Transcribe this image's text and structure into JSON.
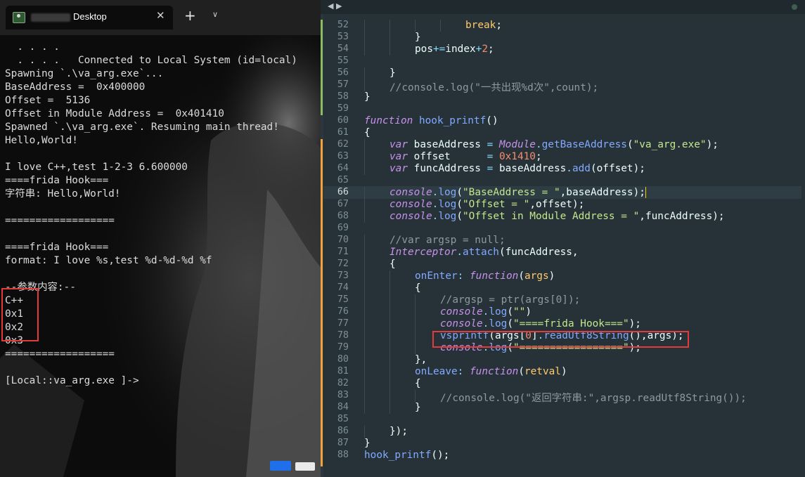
{
  "terminal": {
    "tab_title": "Desktop",
    "close_glyph": "✕",
    "new_tab_glyph": "+",
    "dropdown_glyph": "∨",
    "icon": "terminal-icon",
    "lines": [
      "  . . . .",
      "  . . . .   Connected to Local System (id=local)",
      "Spawning `.\\va_arg.exe`...",
      "BaseAddress =  0x400000",
      "Offset =  5136",
      "Offset in Module Address =  0x401410",
      "Spawned `.\\va_arg.exe`. Resuming main thread!",
      "Hello,World!",
      "",
      "I love C++,test 1-2-3 6.600000",
      "====frida Hook===",
      "字符串: Hello,World!",
      "",
      "==================",
      "",
      "====frida Hook===",
      "format: I love %s,test %d-%d-%d %f",
      "",
      "--参数内容:--",
      "C++",
      "0x1",
      "0x2",
      "0x3",
      "==================",
      "",
      "[Local::va_arg.exe ]->"
    ]
  },
  "editor": {
    "nav_back": "◀",
    "nav_fwd": "▶",
    "active_line": 66,
    "colors": {
      "background": "#263238",
      "keyword": "#c792ea",
      "function": "#82aaff",
      "string": "#c3e88d",
      "number": "#f78c6c",
      "comment": "#8d9aa1",
      "highlight_box": "#e23b3b"
    },
    "line_numbers": [
      "52",
      "53",
      "54",
      "55",
      "56",
      "57",
      "58",
      "59",
      "60",
      "61",
      "62",
      "63",
      "64",
      "65",
      "66",
      "67",
      "68",
      "69",
      "70",
      "71",
      "72",
      "73",
      "74",
      "75",
      "76",
      "77",
      "78",
      "79",
      "80",
      "81",
      "82",
      "83",
      "84",
      "85",
      "86",
      "87",
      "88"
    ],
    "code": [
      {
        "indent": 4,
        "tokens": [
          [
            "kwb",
            "break"
          ],
          [
            "pun",
            ";"
          ]
        ]
      },
      {
        "indent": 2,
        "tokens": [
          [
            "pun",
            "}"
          ]
        ]
      },
      {
        "indent": 2,
        "tokens": [
          [
            "pun",
            "pos"
          ],
          [
            "op",
            "+="
          ],
          [
            "pun",
            "index"
          ],
          [
            "op",
            "+"
          ],
          [
            "num",
            "2"
          ],
          [
            "pun",
            ";"
          ]
        ]
      },
      {
        "indent": 0,
        "tokens": []
      },
      {
        "indent": 1,
        "tokens": [
          [
            "pun",
            "}"
          ]
        ]
      },
      {
        "indent": 1,
        "tokens": [
          [
            "cm",
            "//console.log(\"一共出现%d次\",count);"
          ]
        ]
      },
      {
        "indent": 0,
        "tokens": [
          [
            "pun",
            "}"
          ]
        ]
      },
      {
        "indent": 0,
        "tokens": []
      },
      {
        "indent": 0,
        "tokens": [
          [
            "kw",
            "function"
          ],
          [
            "pun",
            " "
          ],
          [
            "fn",
            "hook_printf"
          ],
          [
            "pun",
            "()"
          ]
        ]
      },
      {
        "indent": 0,
        "tokens": [
          [
            "pun",
            "{"
          ]
        ]
      },
      {
        "indent": 1,
        "tokens": [
          [
            "kw",
            "var"
          ],
          [
            "pun",
            " baseAddress "
          ],
          [
            "op",
            "="
          ],
          [
            "pun",
            " "
          ],
          [
            "cls",
            "Module"
          ],
          [
            "op",
            "."
          ],
          [
            "fn",
            "getBaseAddress"
          ],
          [
            "pun",
            "("
          ],
          [
            "str",
            "\"va_arg.exe\""
          ],
          [
            "pun",
            ");"
          ]
        ]
      },
      {
        "indent": 1,
        "tokens": [
          [
            "kw",
            "var"
          ],
          [
            "pun",
            " offset      "
          ],
          [
            "op",
            "="
          ],
          [
            "pun",
            " "
          ],
          [
            "num",
            "0x1410"
          ],
          [
            "pun",
            ";"
          ]
        ]
      },
      {
        "indent": 1,
        "tokens": [
          [
            "kw",
            "var"
          ],
          [
            "pun",
            " funcAddress "
          ],
          [
            "op",
            "="
          ],
          [
            "pun",
            " baseAddress"
          ],
          [
            "op",
            "."
          ],
          [
            "fn",
            "add"
          ],
          [
            "pun",
            "(offset);"
          ]
        ]
      },
      {
        "indent": 0,
        "tokens": []
      },
      {
        "indent": 1,
        "tokens": [
          [
            "cls",
            "console"
          ],
          [
            "op",
            "."
          ],
          [
            "fn",
            "log"
          ],
          [
            "pun",
            "("
          ],
          [
            "str",
            "\"BaseAddress = \""
          ],
          [
            "pun",
            ",baseAddress);"
          ]
        ],
        "cursor": true
      },
      {
        "indent": 1,
        "tokens": [
          [
            "cls",
            "console"
          ],
          [
            "op",
            "."
          ],
          [
            "fn",
            "log"
          ],
          [
            "pun",
            "("
          ],
          [
            "str",
            "\"Offset = \""
          ],
          [
            "pun",
            ",offset);"
          ]
        ]
      },
      {
        "indent": 1,
        "tokens": [
          [
            "cls",
            "console"
          ],
          [
            "op",
            "."
          ],
          [
            "fn",
            "log"
          ],
          [
            "pun",
            "("
          ],
          [
            "str",
            "\"Offset in Module Address = \""
          ],
          [
            "pun",
            ",funcAddress);"
          ]
        ]
      },
      {
        "indent": 0,
        "tokens": []
      },
      {
        "indent": 1,
        "tokens": [
          [
            "cm",
            "//var argsp = null;"
          ]
        ]
      },
      {
        "indent": 1,
        "tokens": [
          [
            "cls",
            "Interceptor"
          ],
          [
            "op",
            "."
          ],
          [
            "fn",
            "attach"
          ],
          [
            "pun",
            "(funcAddress,"
          ]
        ]
      },
      {
        "indent": 1,
        "tokens": [
          [
            "pun",
            "{"
          ]
        ]
      },
      {
        "indent": 2,
        "tokens": [
          [
            "fn",
            "onEnter"
          ],
          [
            "op",
            ":"
          ],
          [
            "pun",
            " "
          ],
          [
            "kw",
            "function"
          ],
          [
            "pun",
            "("
          ],
          [
            "prm",
            "args"
          ],
          [
            "pun",
            ")"
          ]
        ]
      },
      {
        "indent": 2,
        "tokens": [
          [
            "pun",
            "{"
          ]
        ]
      },
      {
        "indent": 3,
        "tokens": [
          [
            "cm",
            "//argsp = ptr(args[0]);"
          ]
        ]
      },
      {
        "indent": 3,
        "tokens": [
          [
            "cls",
            "console"
          ],
          [
            "op",
            "."
          ],
          [
            "fn",
            "log"
          ],
          [
            "pun",
            "("
          ],
          [
            "str",
            "\"\""
          ],
          [
            "pun",
            ")"
          ]
        ]
      },
      {
        "indent": 3,
        "tokens": [
          [
            "cls",
            "console"
          ],
          [
            "op",
            "."
          ],
          [
            "fn",
            "log"
          ],
          [
            "pun",
            "("
          ],
          [
            "str",
            "\"====frida Hook===\""
          ],
          [
            "pun",
            ");"
          ]
        ]
      },
      {
        "indent": 3,
        "tokens": [
          [
            "fnb",
            "vsprintf"
          ],
          [
            "pun",
            "(args["
          ],
          [
            "num",
            "0"
          ],
          [
            "pun",
            "]"
          ],
          [
            "op",
            "."
          ],
          [
            "fn",
            "readUtf8String"
          ],
          [
            "pun",
            "(),args);"
          ]
        ]
      },
      {
        "indent": 3,
        "tokens": [
          [
            "cls",
            "console"
          ],
          [
            "op",
            "."
          ],
          [
            "fn",
            "log"
          ],
          [
            "pun",
            "("
          ],
          [
            "str",
            "\"=================\""
          ],
          [
            "pun",
            ");"
          ]
        ]
      },
      {
        "indent": 2,
        "tokens": [
          [
            "pun",
            "},"
          ]
        ]
      },
      {
        "indent": 2,
        "tokens": [
          [
            "fn",
            "onLeave"
          ],
          [
            "op",
            ":"
          ],
          [
            "pun",
            " "
          ],
          [
            "kw",
            "function"
          ],
          [
            "pun",
            "("
          ],
          [
            "prm",
            "retval"
          ],
          [
            "pun",
            ")"
          ]
        ]
      },
      {
        "indent": 2,
        "tokens": [
          [
            "pun",
            "{"
          ]
        ]
      },
      {
        "indent": 3,
        "tokens": [
          [
            "cm",
            "//console.log(\"返回字符串:\",argsp.readUtf8String());"
          ]
        ]
      },
      {
        "indent": 2,
        "tokens": [
          [
            "pun",
            "}"
          ]
        ]
      },
      {
        "indent": 0,
        "tokens": []
      },
      {
        "indent": 1,
        "tokens": [
          [
            "pun",
            "});"
          ]
        ]
      },
      {
        "indent": 0,
        "tokens": [
          [
            "pun",
            "}"
          ]
        ]
      },
      {
        "indent": 0,
        "tokens": [
          [
            "fn",
            "hook_printf"
          ],
          [
            "pun",
            "();"
          ]
        ]
      }
    ]
  }
}
